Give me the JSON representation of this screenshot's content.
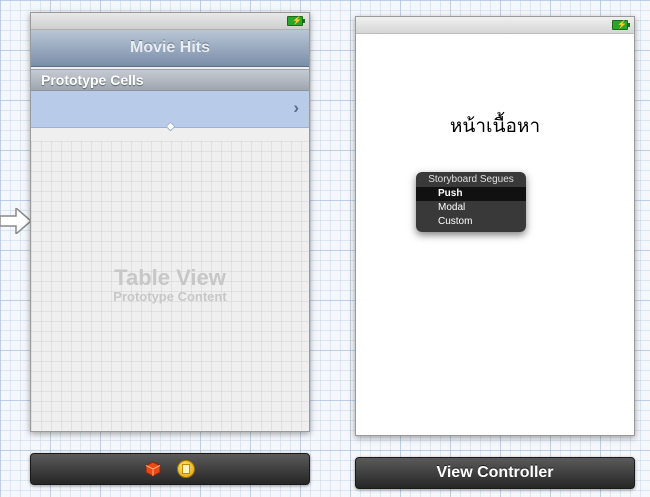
{
  "colors": {
    "selection": "#b8cbe9",
    "navbar_top": "#b9c6d6",
    "navbar_bottom": "#7a8ea9",
    "battery": "#2aa52a",
    "dock": "#2f2f2f"
  },
  "table_view_controller": {
    "nav_title": "Movie Hits",
    "section_header": "Prototype Cells",
    "cell_accessory": "›",
    "placeholder_title": "Table View",
    "placeholder_subtitle": "Prototype Content",
    "status_icon": "battery-icon"
  },
  "view_controller": {
    "label": "หน้าเนื้อหา",
    "status_icon": "battery-icon"
  },
  "segue_menu": {
    "header": "Storyboard Segues",
    "items": [
      "Push",
      "Modal",
      "Custom"
    ]
  },
  "docks": {
    "left_icons": [
      "first-responder-icon",
      "view-controller-icon"
    ],
    "right_label": "View Controller"
  },
  "canvas": {
    "initial_arrow_icon": "entry-arrow-icon"
  }
}
